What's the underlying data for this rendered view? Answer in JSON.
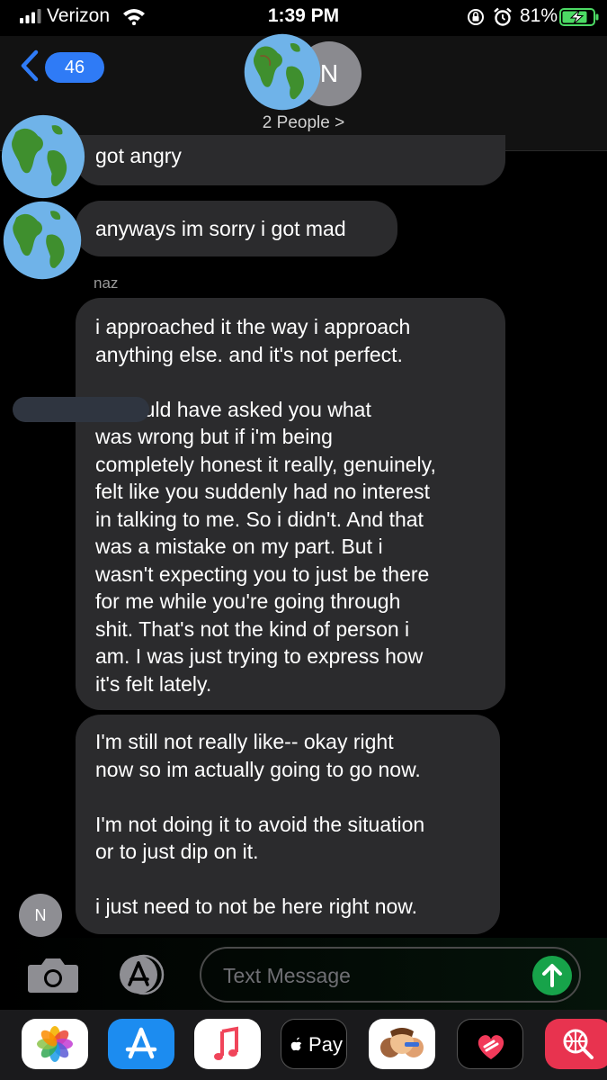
{
  "status_bar": {
    "carrier": "Verizon",
    "time": "1:39 PM",
    "battery_percent": "81%"
  },
  "header": {
    "back_count": "46",
    "avatar_letter": "N",
    "people_label": "2 People >"
  },
  "messages": [
    {
      "text": "got angry"
    },
    {
      "text": "anyways im sorry i got mad"
    },
    {
      "sender": "naz"
    },
    {
      "text": "i approached it the way i approach\nanything else. and it's not perfect.\n\n, i would have asked you what\nwas wrong but if i'm being\ncompletely honest it really, genuinely,\nfelt like you suddenly had no interest\nin talking to me. So i didn't. And that\nwas a mistake on my part. But i\nwasn't expecting you to just be there\nfor me while you're going through\nshit. That's not the kind of person i\nam. I was just trying to express how\nit's felt lately."
    },
    {
      "text": "I'm still not really like-- okay right\nnow so im actually going to go now.\n\nI'm not doing it to avoid the situation\nor to just dip on it.\n\ni just need to not be here right now."
    },
    {
      "avatar_letter": "N"
    }
  ],
  "composer": {
    "placeholder": "Text Message"
  },
  "app_drawer": {
    "apple_pay_label": "Pay"
  },
  "colors": {
    "accent_blue": "#2f7bf6",
    "send_green": "#17a34a",
    "bubble": "#2b2b2d",
    "battery_green": "#4cd964"
  }
}
